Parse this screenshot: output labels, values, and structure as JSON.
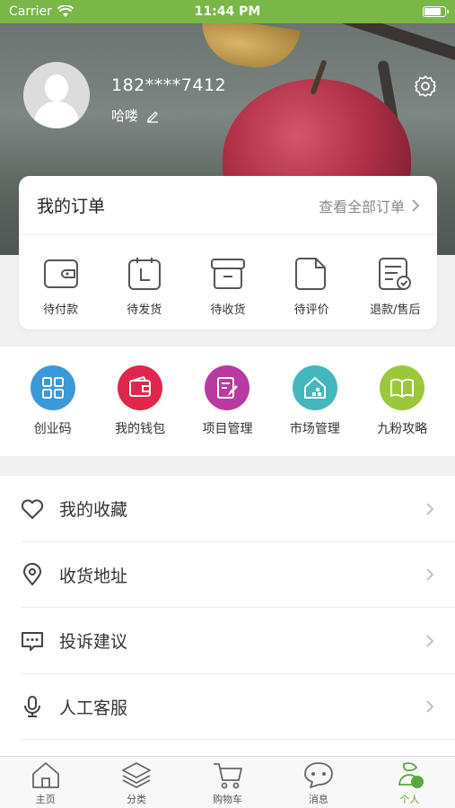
{
  "status": {
    "carrier": "Carrier",
    "time": "11:44 PM"
  },
  "profile": {
    "phone": "182****7412",
    "nickname": "哈喽"
  },
  "orders": {
    "title": "我的订单",
    "view_all": "查看全部订单",
    "items": [
      {
        "label": "待付款",
        "icon": "wallet-icon"
      },
      {
        "label": "待发货",
        "icon": "ship-icon"
      },
      {
        "label": "待收货",
        "icon": "box-icon"
      },
      {
        "label": "待评价",
        "icon": "review-icon"
      },
      {
        "label": "退款/售后",
        "icon": "refund-icon"
      }
    ]
  },
  "services": [
    {
      "label": "创业码",
      "color": "#3a9ad9",
      "icon": "qrcode-icon"
    },
    {
      "label": "我的钱包",
      "color": "#e0264a",
      "icon": "wallet-icon"
    },
    {
      "label": "项目管理",
      "color": "#b93aa0",
      "icon": "edit-icon"
    },
    {
      "label": "市场管理",
      "color": "#43b7bb",
      "icon": "house-icon"
    },
    {
      "label": "九粉攻略",
      "color": "#9bc83b",
      "icon": "book-icon"
    }
  ],
  "menu": [
    {
      "label": "我的收藏",
      "icon": "heart-icon"
    },
    {
      "label": "收货地址",
      "icon": "location-icon"
    },
    {
      "label": "投诉建议",
      "icon": "message-icon"
    },
    {
      "label": "人工客服",
      "icon": "microphone-icon"
    }
  ],
  "tabs": [
    {
      "label": "主页",
      "icon": "home-icon"
    },
    {
      "label": "分类",
      "icon": "layers-icon"
    },
    {
      "label": "购物车",
      "icon": "cart-icon"
    },
    {
      "label": "消息",
      "icon": "chat-icon"
    },
    {
      "label": "个人",
      "icon": "profile-icon",
      "active": true
    }
  ],
  "colors": {
    "accent": "#7ab648",
    "active_tab": "#5aa83a"
  }
}
